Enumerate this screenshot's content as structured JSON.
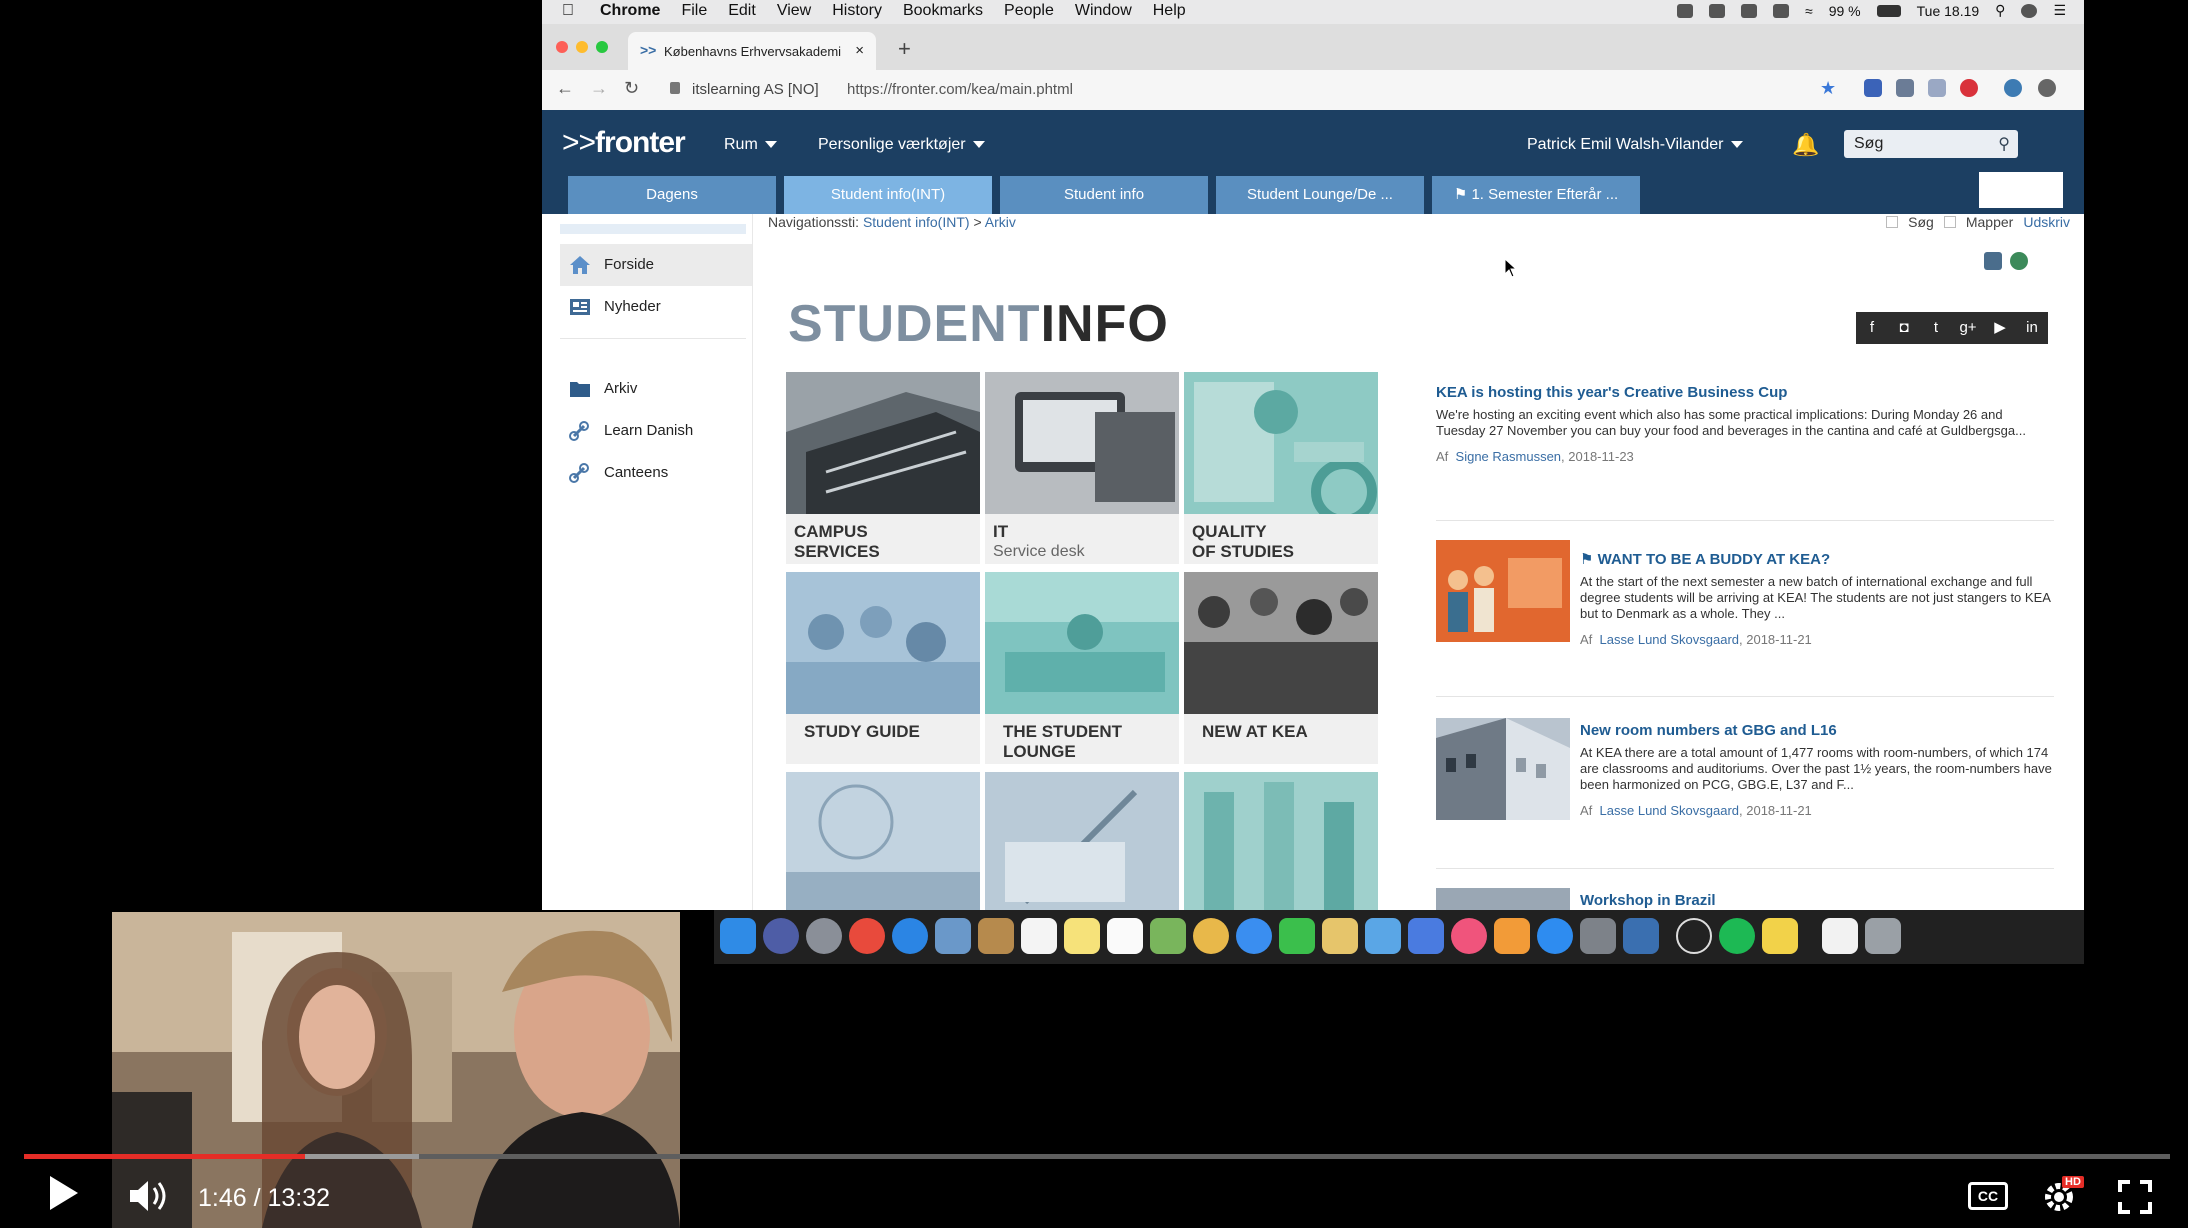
{
  "menubar": {
    "items": [
      "Chrome",
      "File",
      "Edit",
      "View",
      "History",
      "Bookmarks",
      "People",
      "Window",
      "Help"
    ],
    "battery": "99 %",
    "clock": "Tue 18.19"
  },
  "browser": {
    "tab_title": "Københavns Erhvervsakademi",
    "site_label": "itslearning AS [NO]",
    "url": "https://fronter.com/kea/main.phtml"
  },
  "fronter": {
    "logo": "fronter",
    "menu": [
      "Rum",
      "Personlige værktøjer"
    ],
    "user": "Patrick Emil Walsh-Vilander",
    "search_value": "Søg",
    "tabs": [
      "Dagens",
      "Student info(INT)",
      "Student info",
      "Student Lounge/De ...",
      "1. Semester Efterår ..."
    ],
    "active_tab": 1
  },
  "sidebar": {
    "items": [
      "Forside",
      "Nyheder",
      "Arkiv",
      "Learn Danish",
      "Canteens"
    ]
  },
  "breadcrumb": {
    "prefix": "Navigationssti:",
    "path1": "Student info(INT)",
    "sep": ">",
    "path2": "Arkiv",
    "right_items": [
      "Søg",
      "Mapper",
      "Udskriv"
    ]
  },
  "main": {
    "heading_a": "STUDENT",
    "heading_b": "INFO",
    "social": [
      "f",
      "◘",
      "t",
      "g+",
      "▶",
      "in"
    ],
    "tiles": [
      {
        "title": "CAMPUS",
        "title2": "SERVICES",
        "sub": ""
      },
      {
        "title": "IT",
        "title2": "",
        "sub": "Service desk"
      },
      {
        "title": "QUALITY",
        "title2": "OF STUDIES",
        "sub": ""
      },
      {
        "title": "STUDY GUIDE",
        "title2": "",
        "sub": ""
      },
      {
        "title": "THE STUDENT",
        "title2": "LOUNGE",
        "sub": ""
      },
      {
        "title": "NEW AT KEA",
        "title2": "",
        "sub": ""
      }
    ],
    "news": [
      {
        "title": "KEA is hosting this year's Creative Business Cup",
        "body": "We're hosting an exciting event which also has some practical implications: During Monday 26 and Tuesday 27 November you can buy your food and beverages in the cantina and café at Guldbergsga...",
        "by_prefix": "Af",
        "author": "Signe Rasmussen",
        "date": ", 2018-11-23"
      },
      {
        "title": "WANT TO BE A BUDDY AT KEA?",
        "body": "At the start of the next semester a new batch of international exchange and full degree students will be arriving at KEA! The students are not just stangers to KEA but to Denmark as a whole. They ...",
        "by_prefix": "Af",
        "author": "Lasse Lund Skovsgaard",
        "date": ", 2018-11-21"
      },
      {
        "title": "New room numbers at GBG and L16",
        "body": "At KEA there are a total amount of 1,477 rooms with room-numbers, of which 174 are classrooms and auditoriums. Over the past 1½ years, the room-numbers have been harmonized on PCG, GBG.E, L37 and F...",
        "by_prefix": "Af",
        "author": "Lasse Lund Skovsgaard",
        "date": ", 2018-11-21"
      },
      {
        "title": "Workshop in Brazil",
        "body": "",
        "by_prefix": "",
        "author": "",
        "date": ""
      }
    ]
  },
  "player": {
    "time": "1:46 / 13:32",
    "progress_fraction": 0.131,
    "buffered_fraction": 0.184,
    "cc_label": "CC",
    "hd_label": "HD",
    "accent": "#e52d27"
  },
  "colors": {
    "fronter_header": "#1c3f62",
    "tab_bg": "#5a8fc0",
    "tab_active": "#7db4e3",
    "link": "#1f5c92"
  }
}
